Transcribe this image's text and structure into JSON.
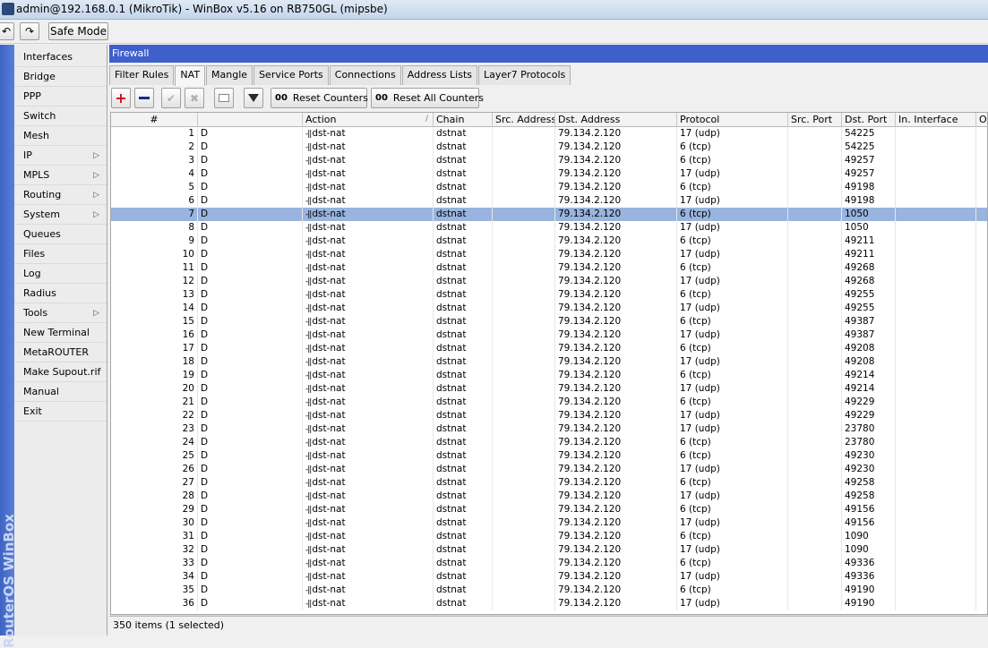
{
  "window": {
    "title": "admin@192.168.0.1 (MikroTik) - WinBox v5.16 on RB750GL (mipsbe)"
  },
  "toolbar": {
    "undo_icon": "undo-icon",
    "redo_icon": "redo-icon",
    "safe_mode_label": "Safe Mode"
  },
  "brand": {
    "vertical_text": "RouterOS WinBox"
  },
  "sidebar": {
    "items": [
      {
        "label": "Interfaces",
        "submenu": false
      },
      {
        "label": "Bridge",
        "submenu": false
      },
      {
        "label": "PPP",
        "submenu": false
      },
      {
        "label": "Switch",
        "submenu": false
      },
      {
        "label": "Mesh",
        "submenu": false
      },
      {
        "label": "IP",
        "submenu": true
      },
      {
        "label": "MPLS",
        "submenu": true
      },
      {
        "label": "Routing",
        "submenu": true
      },
      {
        "label": "System",
        "submenu": true
      },
      {
        "label": "Queues",
        "submenu": false
      },
      {
        "label": "Files",
        "submenu": false
      },
      {
        "label": "Log",
        "submenu": false
      },
      {
        "label": "Radius",
        "submenu": false
      },
      {
        "label": "Tools",
        "submenu": true
      },
      {
        "label": "New Terminal",
        "submenu": false
      },
      {
        "label": "MetaROUTER",
        "submenu": false
      },
      {
        "label": "Make Supout.rif",
        "submenu": false
      },
      {
        "label": "Manual",
        "submenu": false
      },
      {
        "label": "Exit",
        "submenu": false
      }
    ]
  },
  "firewall": {
    "title": "Firewall",
    "tabs": [
      {
        "label": "Filter Rules",
        "active": false
      },
      {
        "label": "NAT",
        "active": true
      },
      {
        "label": "Mangle",
        "active": false
      },
      {
        "label": "Service Ports",
        "active": false
      },
      {
        "label": "Connections",
        "active": false
      },
      {
        "label": "Address Lists",
        "active": false
      },
      {
        "label": "Layer7 Protocols",
        "active": false
      }
    ],
    "buttons": {
      "reset_counters": "Reset Counters",
      "reset_all_counters": "Reset All Counters",
      "counter_glyph": "00"
    },
    "columns": [
      "#",
      "",
      "Action",
      "Chain",
      "Src. Address",
      "Dst. Address",
      "Protocol",
      "Src. Port",
      "Dst. Port",
      "In. Interface",
      "Ou"
    ],
    "rows": [
      {
        "num": "1",
        "flag": "D",
        "action": "dst-nat",
        "chain": "dstnat",
        "dst": "79.134.2.120",
        "proto": "17 (udp)",
        "dport": "54225"
      },
      {
        "num": "2",
        "flag": "D",
        "action": "dst-nat",
        "chain": "dstnat",
        "dst": "79.134.2.120",
        "proto": "6 (tcp)",
        "dport": "54225"
      },
      {
        "num": "3",
        "flag": "D",
        "action": "dst-nat",
        "chain": "dstnat",
        "dst": "79.134.2.120",
        "proto": "6 (tcp)",
        "dport": "49257"
      },
      {
        "num": "4",
        "flag": "D",
        "action": "dst-nat",
        "chain": "dstnat",
        "dst": "79.134.2.120",
        "proto": "17 (udp)",
        "dport": "49257"
      },
      {
        "num": "5",
        "flag": "D",
        "action": "dst-nat",
        "chain": "dstnat",
        "dst": "79.134.2.120",
        "proto": "6 (tcp)",
        "dport": "49198"
      },
      {
        "num": "6",
        "flag": "D",
        "action": "dst-nat",
        "chain": "dstnat",
        "dst": "79.134.2.120",
        "proto": "17 (udp)",
        "dport": "49198"
      },
      {
        "num": "7",
        "flag": "D",
        "action": "dst-nat",
        "chain": "dstnat",
        "dst": "79.134.2.120",
        "proto": "6 (tcp)",
        "dport": "1050",
        "selected": true
      },
      {
        "num": "8",
        "flag": "D",
        "action": "dst-nat",
        "chain": "dstnat",
        "dst": "79.134.2.120",
        "proto": "17 (udp)",
        "dport": "1050"
      },
      {
        "num": "9",
        "flag": "D",
        "action": "dst-nat",
        "chain": "dstnat",
        "dst": "79.134.2.120",
        "proto": "6 (tcp)",
        "dport": "49211"
      },
      {
        "num": "10",
        "flag": "D",
        "action": "dst-nat",
        "chain": "dstnat",
        "dst": "79.134.2.120",
        "proto": "17 (udp)",
        "dport": "49211"
      },
      {
        "num": "11",
        "flag": "D",
        "action": "dst-nat",
        "chain": "dstnat",
        "dst": "79.134.2.120",
        "proto": "6 (tcp)",
        "dport": "49268"
      },
      {
        "num": "12",
        "flag": "D",
        "action": "dst-nat",
        "chain": "dstnat",
        "dst": "79.134.2.120",
        "proto": "17 (udp)",
        "dport": "49268"
      },
      {
        "num": "13",
        "flag": "D",
        "action": "dst-nat",
        "chain": "dstnat",
        "dst": "79.134.2.120",
        "proto": "6 (tcp)",
        "dport": "49255"
      },
      {
        "num": "14",
        "flag": "D",
        "action": "dst-nat",
        "chain": "dstnat",
        "dst": "79.134.2.120",
        "proto": "17 (udp)",
        "dport": "49255"
      },
      {
        "num": "15",
        "flag": "D",
        "action": "dst-nat",
        "chain": "dstnat",
        "dst": "79.134.2.120",
        "proto": "6 (tcp)",
        "dport": "49387"
      },
      {
        "num": "16",
        "flag": "D",
        "action": "dst-nat",
        "chain": "dstnat",
        "dst": "79.134.2.120",
        "proto": "17 (udp)",
        "dport": "49387"
      },
      {
        "num": "17",
        "flag": "D",
        "action": "dst-nat",
        "chain": "dstnat",
        "dst": "79.134.2.120",
        "proto": "6 (tcp)",
        "dport": "49208"
      },
      {
        "num": "18",
        "flag": "D",
        "action": "dst-nat",
        "chain": "dstnat",
        "dst": "79.134.2.120",
        "proto": "17 (udp)",
        "dport": "49208"
      },
      {
        "num": "19",
        "flag": "D",
        "action": "dst-nat",
        "chain": "dstnat",
        "dst": "79.134.2.120",
        "proto": "6 (tcp)",
        "dport": "49214"
      },
      {
        "num": "20",
        "flag": "D",
        "action": "dst-nat",
        "chain": "dstnat",
        "dst": "79.134.2.120",
        "proto": "17 (udp)",
        "dport": "49214"
      },
      {
        "num": "21",
        "flag": "D",
        "action": "dst-nat",
        "chain": "dstnat",
        "dst": "79.134.2.120",
        "proto": "6 (tcp)",
        "dport": "49229"
      },
      {
        "num": "22",
        "flag": "D",
        "action": "dst-nat",
        "chain": "dstnat",
        "dst": "79.134.2.120",
        "proto": "17 (udp)",
        "dport": "49229"
      },
      {
        "num": "23",
        "flag": "D",
        "action": "dst-nat",
        "chain": "dstnat",
        "dst": "79.134.2.120",
        "proto": "17 (udp)",
        "dport": "23780"
      },
      {
        "num": "24",
        "flag": "D",
        "action": "dst-nat",
        "chain": "dstnat",
        "dst": "79.134.2.120",
        "proto": "6 (tcp)",
        "dport": "23780"
      },
      {
        "num": "25",
        "flag": "D",
        "action": "dst-nat",
        "chain": "dstnat",
        "dst": "79.134.2.120",
        "proto": "6 (tcp)",
        "dport": "49230"
      },
      {
        "num": "26",
        "flag": "D",
        "action": "dst-nat",
        "chain": "dstnat",
        "dst": "79.134.2.120",
        "proto": "17 (udp)",
        "dport": "49230"
      },
      {
        "num": "27",
        "flag": "D",
        "action": "dst-nat",
        "chain": "dstnat",
        "dst": "79.134.2.120",
        "proto": "6 (tcp)",
        "dport": "49258"
      },
      {
        "num": "28",
        "flag": "D",
        "action": "dst-nat",
        "chain": "dstnat",
        "dst": "79.134.2.120",
        "proto": "17 (udp)",
        "dport": "49258"
      },
      {
        "num": "29",
        "flag": "D",
        "action": "dst-nat",
        "chain": "dstnat",
        "dst": "79.134.2.120",
        "proto": "6 (tcp)",
        "dport": "49156"
      },
      {
        "num": "30",
        "flag": "D",
        "action": "dst-nat",
        "chain": "dstnat",
        "dst": "79.134.2.120",
        "proto": "17 (udp)",
        "dport": "49156"
      },
      {
        "num": "31",
        "flag": "D",
        "action": "dst-nat",
        "chain": "dstnat",
        "dst": "79.134.2.120",
        "proto": "6 (tcp)",
        "dport": "1090"
      },
      {
        "num": "32",
        "flag": "D",
        "action": "dst-nat",
        "chain": "dstnat",
        "dst": "79.134.2.120",
        "proto": "17 (udp)",
        "dport": "1090"
      },
      {
        "num": "33",
        "flag": "D",
        "action": "dst-nat",
        "chain": "dstnat",
        "dst": "79.134.2.120",
        "proto": "6 (tcp)",
        "dport": "49336"
      },
      {
        "num": "34",
        "flag": "D",
        "action": "dst-nat",
        "chain": "dstnat",
        "dst": "79.134.2.120",
        "proto": "17 (udp)",
        "dport": "49336"
      },
      {
        "num": "35",
        "flag": "D",
        "action": "dst-nat",
        "chain": "dstnat",
        "dst": "79.134.2.120",
        "proto": "6 (tcp)",
        "dport": "49190"
      },
      {
        "num": "36",
        "flag": "D",
        "action": "dst-nat",
        "chain": "dstnat",
        "dst": "79.134.2.120",
        "proto": "17 (udp)",
        "dport": "49190"
      }
    ],
    "status": "350 items (1 selected)"
  },
  "colors": {
    "brand_blue": "#3f5fcb",
    "selection": "#99b4de"
  }
}
